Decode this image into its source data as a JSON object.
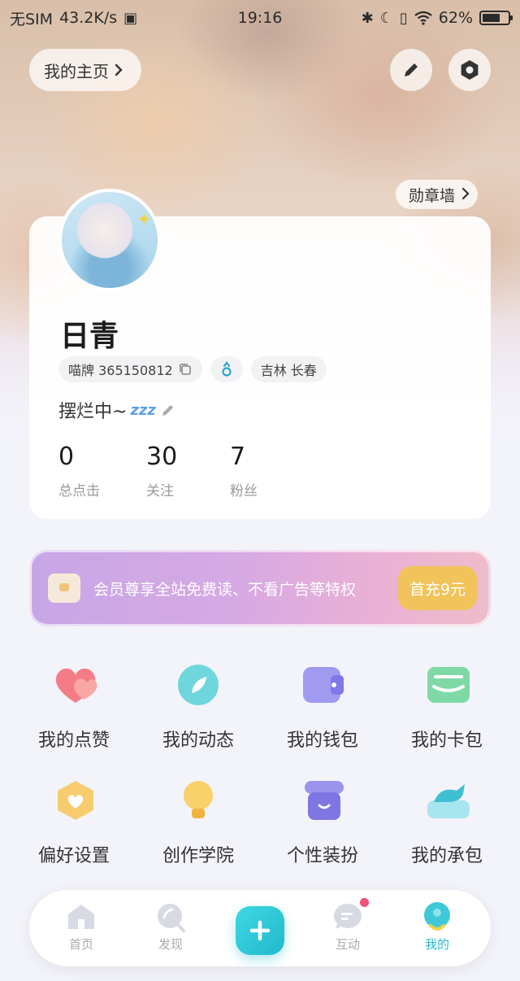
{
  "status_bar": {
    "carrier": "无SIM",
    "speed": "43.2K/s",
    "time": "19:16",
    "battery": "62%"
  },
  "header": {
    "home_label": "我的主页",
    "medal_wall_label": "勋章墙"
  },
  "profile": {
    "name": "日青",
    "id_label": "喵牌 365150812",
    "gender_icon": "male-icon",
    "location": "吉林 长春",
    "bio": "摆烂中~",
    "bio_emoji": "zzz",
    "stats": [
      {
        "value": "0",
        "label": "总点击"
      },
      {
        "value": "30",
        "label": "关注"
      },
      {
        "value": "7",
        "label": "粉丝"
      }
    ]
  },
  "vip_banner": {
    "text": "会员尊享全站免费读、不看广告等特权",
    "button": "首充9元"
  },
  "grid": [
    {
      "label": "我的点赞",
      "icon": "heart-icon"
    },
    {
      "label": "我的动态",
      "icon": "leaf-icon"
    },
    {
      "label": "我的钱包",
      "icon": "wallet-icon"
    },
    {
      "label": "我的卡包",
      "icon": "card-icon"
    },
    {
      "label": "偏好设置",
      "icon": "preference-icon"
    },
    {
      "label": "创作学院",
      "icon": "lightbulb-icon"
    },
    {
      "label": "个性装扮",
      "icon": "store-icon"
    },
    {
      "label": "我的承包",
      "icon": "whale-icon"
    }
  ],
  "nav": [
    {
      "label": "首页",
      "icon": "home-icon"
    },
    {
      "label": "发现",
      "icon": "discover-icon"
    },
    {
      "label": "互动",
      "icon": "chat-icon"
    },
    {
      "label": "我的",
      "icon": "profile-icon"
    }
  ],
  "colors": {
    "accent": "#2ab6cf",
    "vip_button": "#f2c35a",
    "badge": "#f0507a"
  }
}
